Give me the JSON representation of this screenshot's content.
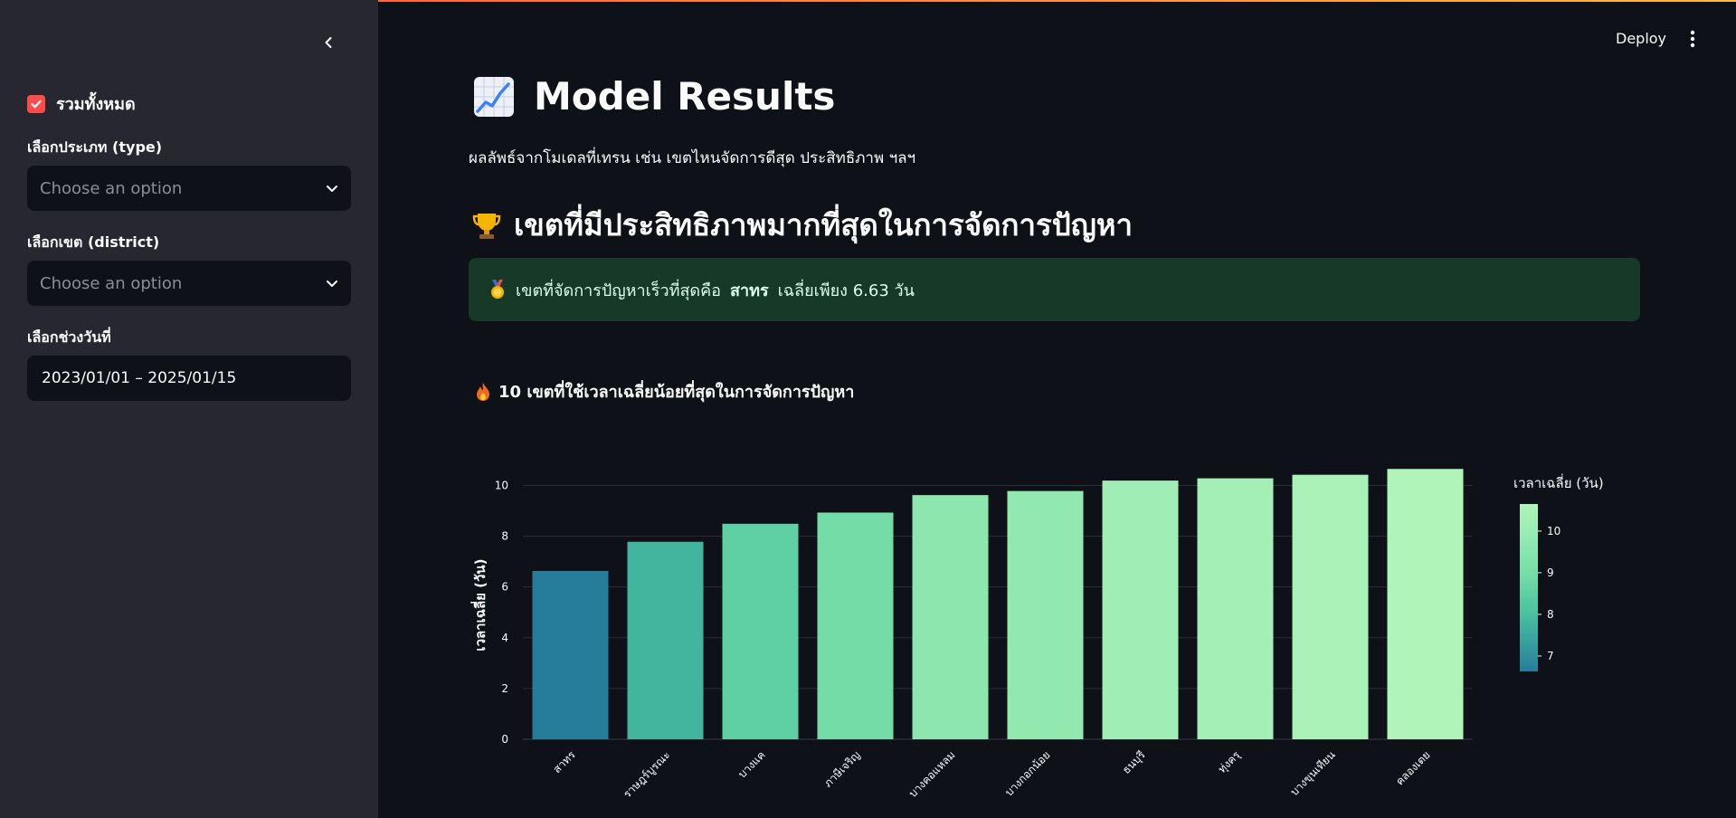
{
  "sidebar": {
    "all_checkbox_label": "รวมทั้งหมด",
    "type_label": "เลือกประเภท (type)",
    "type_placeholder": "Choose an option",
    "district_label": "เลือกเขต (district)",
    "district_placeholder": "Choose an option",
    "date_label": "เลือกช่วงวันที่",
    "date_value": "2023/01/01 – 2025/01/15"
  },
  "header": {
    "deploy_label": "Deploy"
  },
  "main": {
    "title": "Model Results",
    "subtitle": "ผลลัพธ์จากโมเดลที่เทรน เช่น เขตไหนจัดการดีสุด ประสิทธิภาพ ฯลฯ",
    "section_title": "เขตที่มีประสิทธิภาพมากที่สุดในการจัดการปัญหา",
    "alert_prefix": "เขตที่จัดการปัญหาเร็วที่สุดคือ",
    "alert_district": "สาทร",
    "alert_suffix": "เฉลี่ยเพียง 6.63 วัน",
    "chart_heading": "10 เขตที่ใช้เวลาเฉลี่ยน้อยที่สุดในการจัดการปัญหา"
  },
  "colors": {
    "accent": "#ff4b4b",
    "alert_bg": "#173928",
    "sidebar_bg": "#262730",
    "app_bg": "#0e1117"
  },
  "chart_data": {
    "type": "bar",
    "categories": [
      "สาทร",
      "ราษฎร์บูรณะ",
      "บางแค",
      "ภาษีเจริญ",
      "บางคอแหลม",
      "บางกอกน้อย",
      "ธนบุรี",
      "ทุ่งครุ",
      "บางขุนเทียน",
      "คลองเตย"
    ],
    "values": [
      6.63,
      7.78,
      8.49,
      8.93,
      9.62,
      9.78,
      10.19,
      10.28,
      10.42,
      10.65
    ],
    "ylabel": "เวลาเฉลี่ย (วัน)",
    "ylim": [
      0,
      11.3
    ],
    "yticks": [
      0,
      2,
      4,
      6,
      8,
      10
    ],
    "grid": true,
    "colorbar": {
      "title": "เวลาเฉลี่ย (วัน)",
      "ticks": [
        7,
        8,
        9,
        10
      ],
      "range": [
        6.63,
        10.65
      ]
    }
  }
}
